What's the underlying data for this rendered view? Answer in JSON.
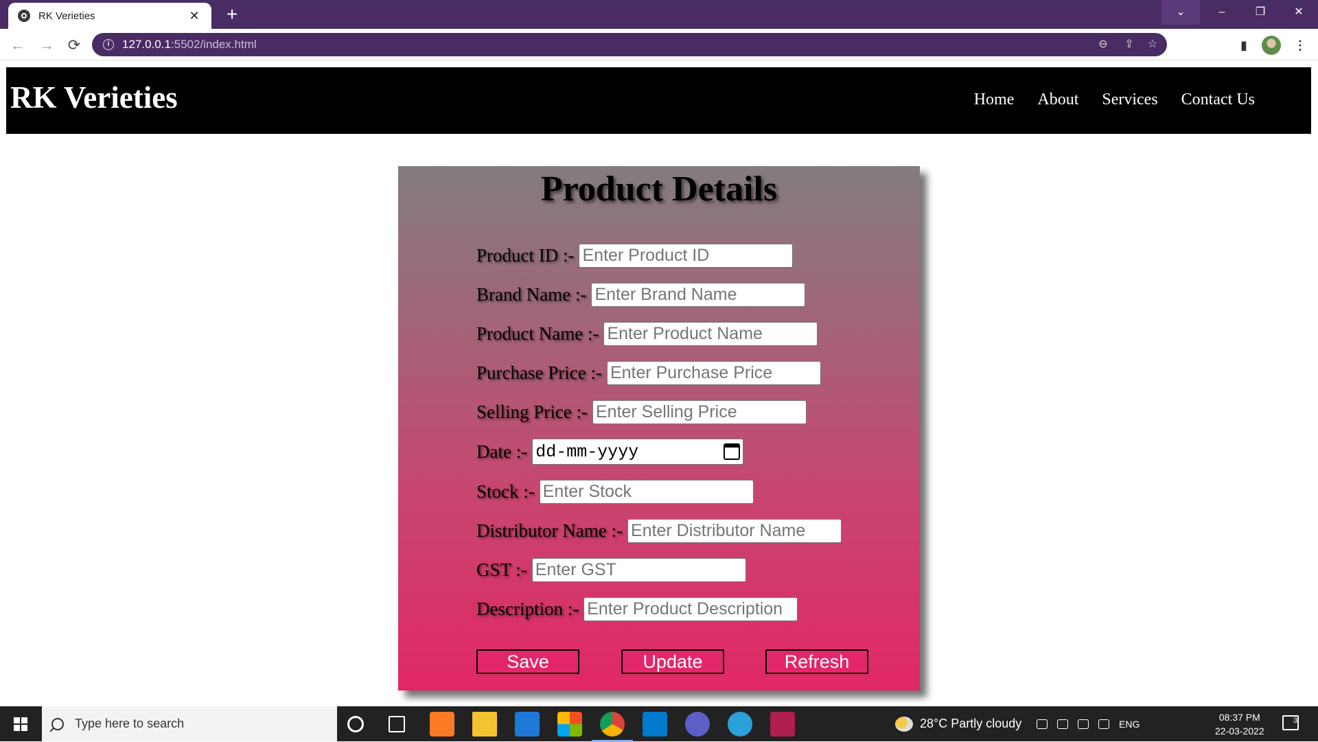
{
  "browser": {
    "tab_title": "RK Verieties",
    "tab_close": "✕",
    "new_tab": "+",
    "url_host": "127.0.0.1",
    "url_rest": ":5502/index.html",
    "window_controls": {
      "tab_search": "⌄",
      "minimize": "–",
      "maximize": "❐",
      "close": "✕"
    },
    "nav": {
      "back": "←",
      "forward": "→",
      "reload": "⟳"
    },
    "icons": {
      "zoom": "⊖",
      "share": "⇪",
      "star": "☆",
      "side_panel": "▮",
      "menu": "⋮"
    }
  },
  "site": {
    "brand": "RK Verieties",
    "nav": [
      "Home",
      "About",
      "Services",
      "Contact Us"
    ]
  },
  "form": {
    "title": "Product Details",
    "fields": [
      {
        "label": "Product ID :-",
        "placeholder": "Enter Product ID"
      },
      {
        "label": "Brand Name :-",
        "placeholder": "Enter Brand Name"
      },
      {
        "label": "Product Name :-",
        "placeholder": "Enter Product Name"
      },
      {
        "label": "Purchase Price :-",
        "placeholder": "Enter Purchase Price"
      },
      {
        "label": "Selling Price :-",
        "placeholder": "Enter Selling Price"
      },
      {
        "label": "Date :-",
        "placeholder": "dd-mm-yyyy"
      },
      {
        "label": "Stock :-",
        "placeholder": "Enter Stock"
      },
      {
        "label": "Distributor Name :-",
        "placeholder": "Enter Distributor Name"
      },
      {
        "label": "GST :-",
        "placeholder": "Enter GST"
      },
      {
        "label": "Description :-",
        "placeholder": "Enter Product Description"
      }
    ],
    "buttons": {
      "save": "Save",
      "update": "Update",
      "refresh": "Refresh"
    }
  },
  "taskbar": {
    "search_placeholder": "Type here to search",
    "weather": "28°C  Partly cloudy",
    "language": "ENG",
    "time": "08:37 PM",
    "date": "22-03-2022",
    "notifications": "3"
  },
  "colors": {
    "chrome_accent": "#4a2c64",
    "header_bg": "#000000",
    "card_top": "#837c80",
    "card_bottom": "#e12765",
    "button_bg": "#e3266a"
  }
}
